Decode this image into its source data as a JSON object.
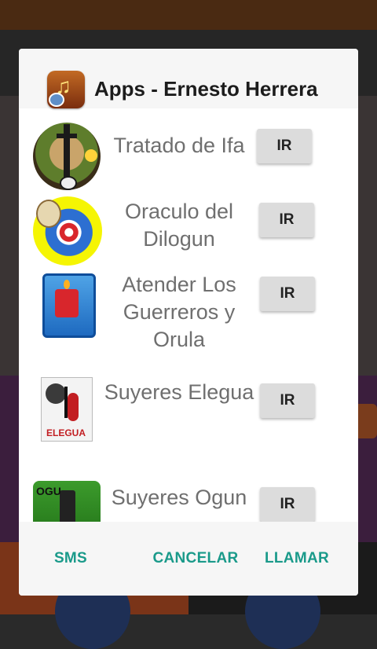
{
  "dialog": {
    "title": "Apps - Ernesto Herrera",
    "icon": "music-note-app-icon",
    "apps": [
      {
        "name": "Tratado de Ifa",
        "icon": "ifa-tray-icon",
        "button": "IR"
      },
      {
        "name": "Oraculo del Dilogun",
        "icon": "dilogun-target-icon",
        "button": "IR"
      },
      {
        "name": "Atender Los Guerreros y Orula",
        "icon": "candle-icon",
        "button": "IR"
      },
      {
        "name": "Suyeres Elegua",
        "icon": "elegua-music-icon",
        "button": "IR",
        "icon_label": "ELEGUA"
      },
      {
        "name": "Suyeres Ogun",
        "icon": "ogun-icon",
        "button": "IR",
        "icon_label": "OGU"
      }
    ],
    "footer": {
      "sms": "SMS",
      "cancel": "CANCELAR",
      "call": "LLAMAR"
    }
  },
  "colors": {
    "accent": "#1a9a8a",
    "button_bg": "#dcdcdc",
    "app_name": "#6f6f6f"
  }
}
